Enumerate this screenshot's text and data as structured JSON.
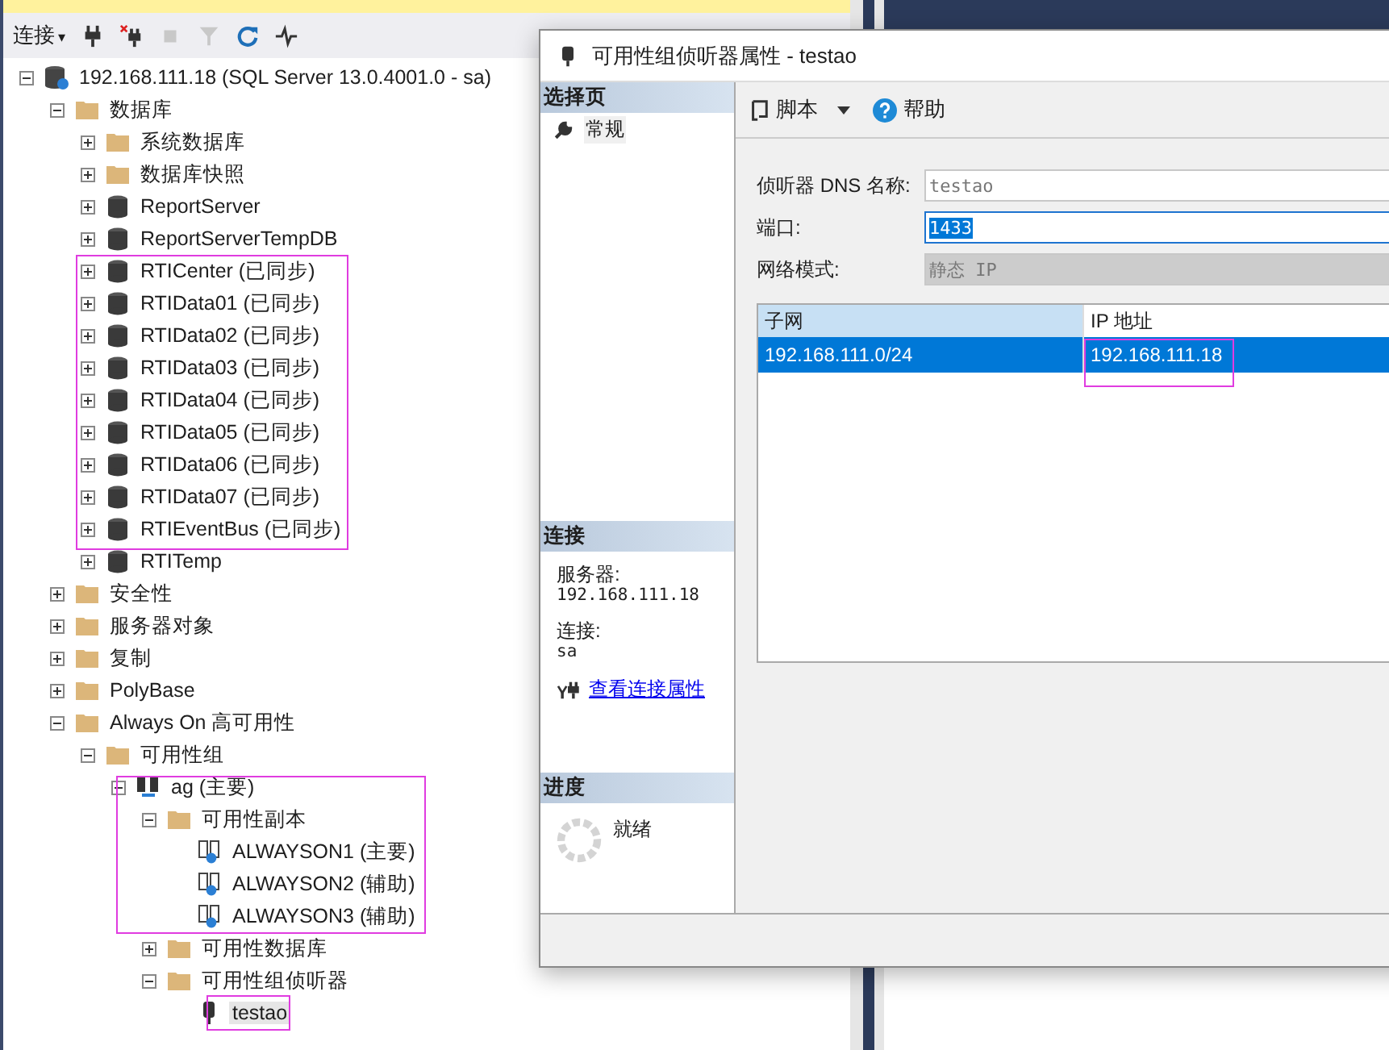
{
  "explorer": {
    "toolbar": {
      "connect_label": "连接",
      "connect_caret": "▾"
    },
    "tree": [
      {
        "kind": "server",
        "label": "192.168.111.18 (SQL Server 13.0.4001.0 - sa)",
        "expanded": true,
        "children": [
          {
            "kind": "folder",
            "label": "数据库",
            "expanded": true,
            "children": [
              {
                "kind": "folder",
                "label": "系统数据库",
                "expanded": false
              },
              {
                "kind": "folder",
                "label": "数据库快照",
                "expanded": false
              },
              {
                "kind": "db",
                "label": "ReportServer",
                "expanded": false
              },
              {
                "kind": "db",
                "label": "ReportServerTempDB",
                "expanded": false
              },
              {
                "kind": "db",
                "label": "RTICenter (已同步)",
                "expanded": false
              },
              {
                "kind": "db",
                "label": "RTIData01 (已同步)",
                "expanded": false
              },
              {
                "kind": "db",
                "label": "RTIData02 (已同步)",
                "expanded": false
              },
              {
                "kind": "db",
                "label": "RTIData03 (已同步)",
                "expanded": false
              },
              {
                "kind": "db",
                "label": "RTIData04 (已同步)",
                "expanded": false
              },
              {
                "kind": "db",
                "label": "RTIData05 (已同步)",
                "expanded": false
              },
              {
                "kind": "db",
                "label": "RTIData06 (已同步)",
                "expanded": false
              },
              {
                "kind": "db",
                "label": "RTIData07 (已同步)",
                "expanded": false
              },
              {
                "kind": "db",
                "label": "RTIEventBus (已同步)",
                "expanded": false
              },
              {
                "kind": "db",
                "label": "RTITemp",
                "expanded": false
              }
            ]
          },
          {
            "kind": "folder",
            "label": "安全性",
            "expanded": false
          },
          {
            "kind": "folder",
            "label": "服务器对象",
            "expanded": false
          },
          {
            "kind": "folder",
            "label": "复制",
            "expanded": false
          },
          {
            "kind": "folder",
            "label": "PolyBase",
            "expanded": false
          },
          {
            "kind": "folder",
            "label": "Always On 高可用性",
            "expanded": true,
            "children": [
              {
                "kind": "folder",
                "label": "可用性组",
                "expanded": true,
                "children": [
                  {
                    "kind": "ag",
                    "label": "ag (主要)",
                    "expanded": true,
                    "children": [
                      {
                        "kind": "folder",
                        "label": "可用性副本",
                        "expanded": true,
                        "children": [
                          {
                            "kind": "replica",
                            "label": "ALWAYSON1 (主要)"
                          },
                          {
                            "kind": "replica",
                            "label": "ALWAYSON2 (辅助)"
                          },
                          {
                            "kind": "replica",
                            "label": "ALWAYSON3 (辅助)"
                          }
                        ]
                      },
                      {
                        "kind": "folder",
                        "label": "可用性数据库",
                        "expanded": false
                      },
                      {
                        "kind": "folder",
                        "label": "可用性组侦听器",
                        "expanded": true,
                        "children": [
                          {
                            "kind": "listener",
                            "label": "testao",
                            "selected": true
                          }
                        ]
                      }
                    ]
                  }
                ]
              }
            ]
          }
        ]
      }
    ]
  },
  "dialog": {
    "title": "可用性组侦听器属性 - testao",
    "select_page": {
      "header": "选择页",
      "items": [
        {
          "label": "常规",
          "selected": true
        }
      ]
    },
    "connection": {
      "header": "连接",
      "server_label": "服务器:",
      "server": "192.168.111.18",
      "connection_label": "连接:",
      "connection": "sa",
      "link": "查看连接属性"
    },
    "progress": {
      "header": "进度",
      "status": "就绪"
    },
    "toolbar": {
      "script": "脚本",
      "help": "帮助"
    },
    "fields": [
      {
        "kind": "text",
        "label": "侦听器 DNS 名称:",
        "value": "testao",
        "disabled": true,
        "focused": false
      },
      {
        "kind": "text",
        "label": "端口:",
        "value": "1433",
        "disabled": false,
        "focused": true
      },
      {
        "kind": "dropdown",
        "label": "网络模式:",
        "value": "静态 IP",
        "disabled": true,
        "focused": false
      }
    ],
    "grid": {
      "columns": [
        {
          "label": "子网",
          "selected": true
        },
        {
          "label": "IP 地址",
          "selected": false
        }
      ],
      "rows": [
        {
          "cells": [
            "192.168.111.0/24",
            "192.168.111.18"
          ],
          "selected": true
        }
      ]
    }
  }
}
